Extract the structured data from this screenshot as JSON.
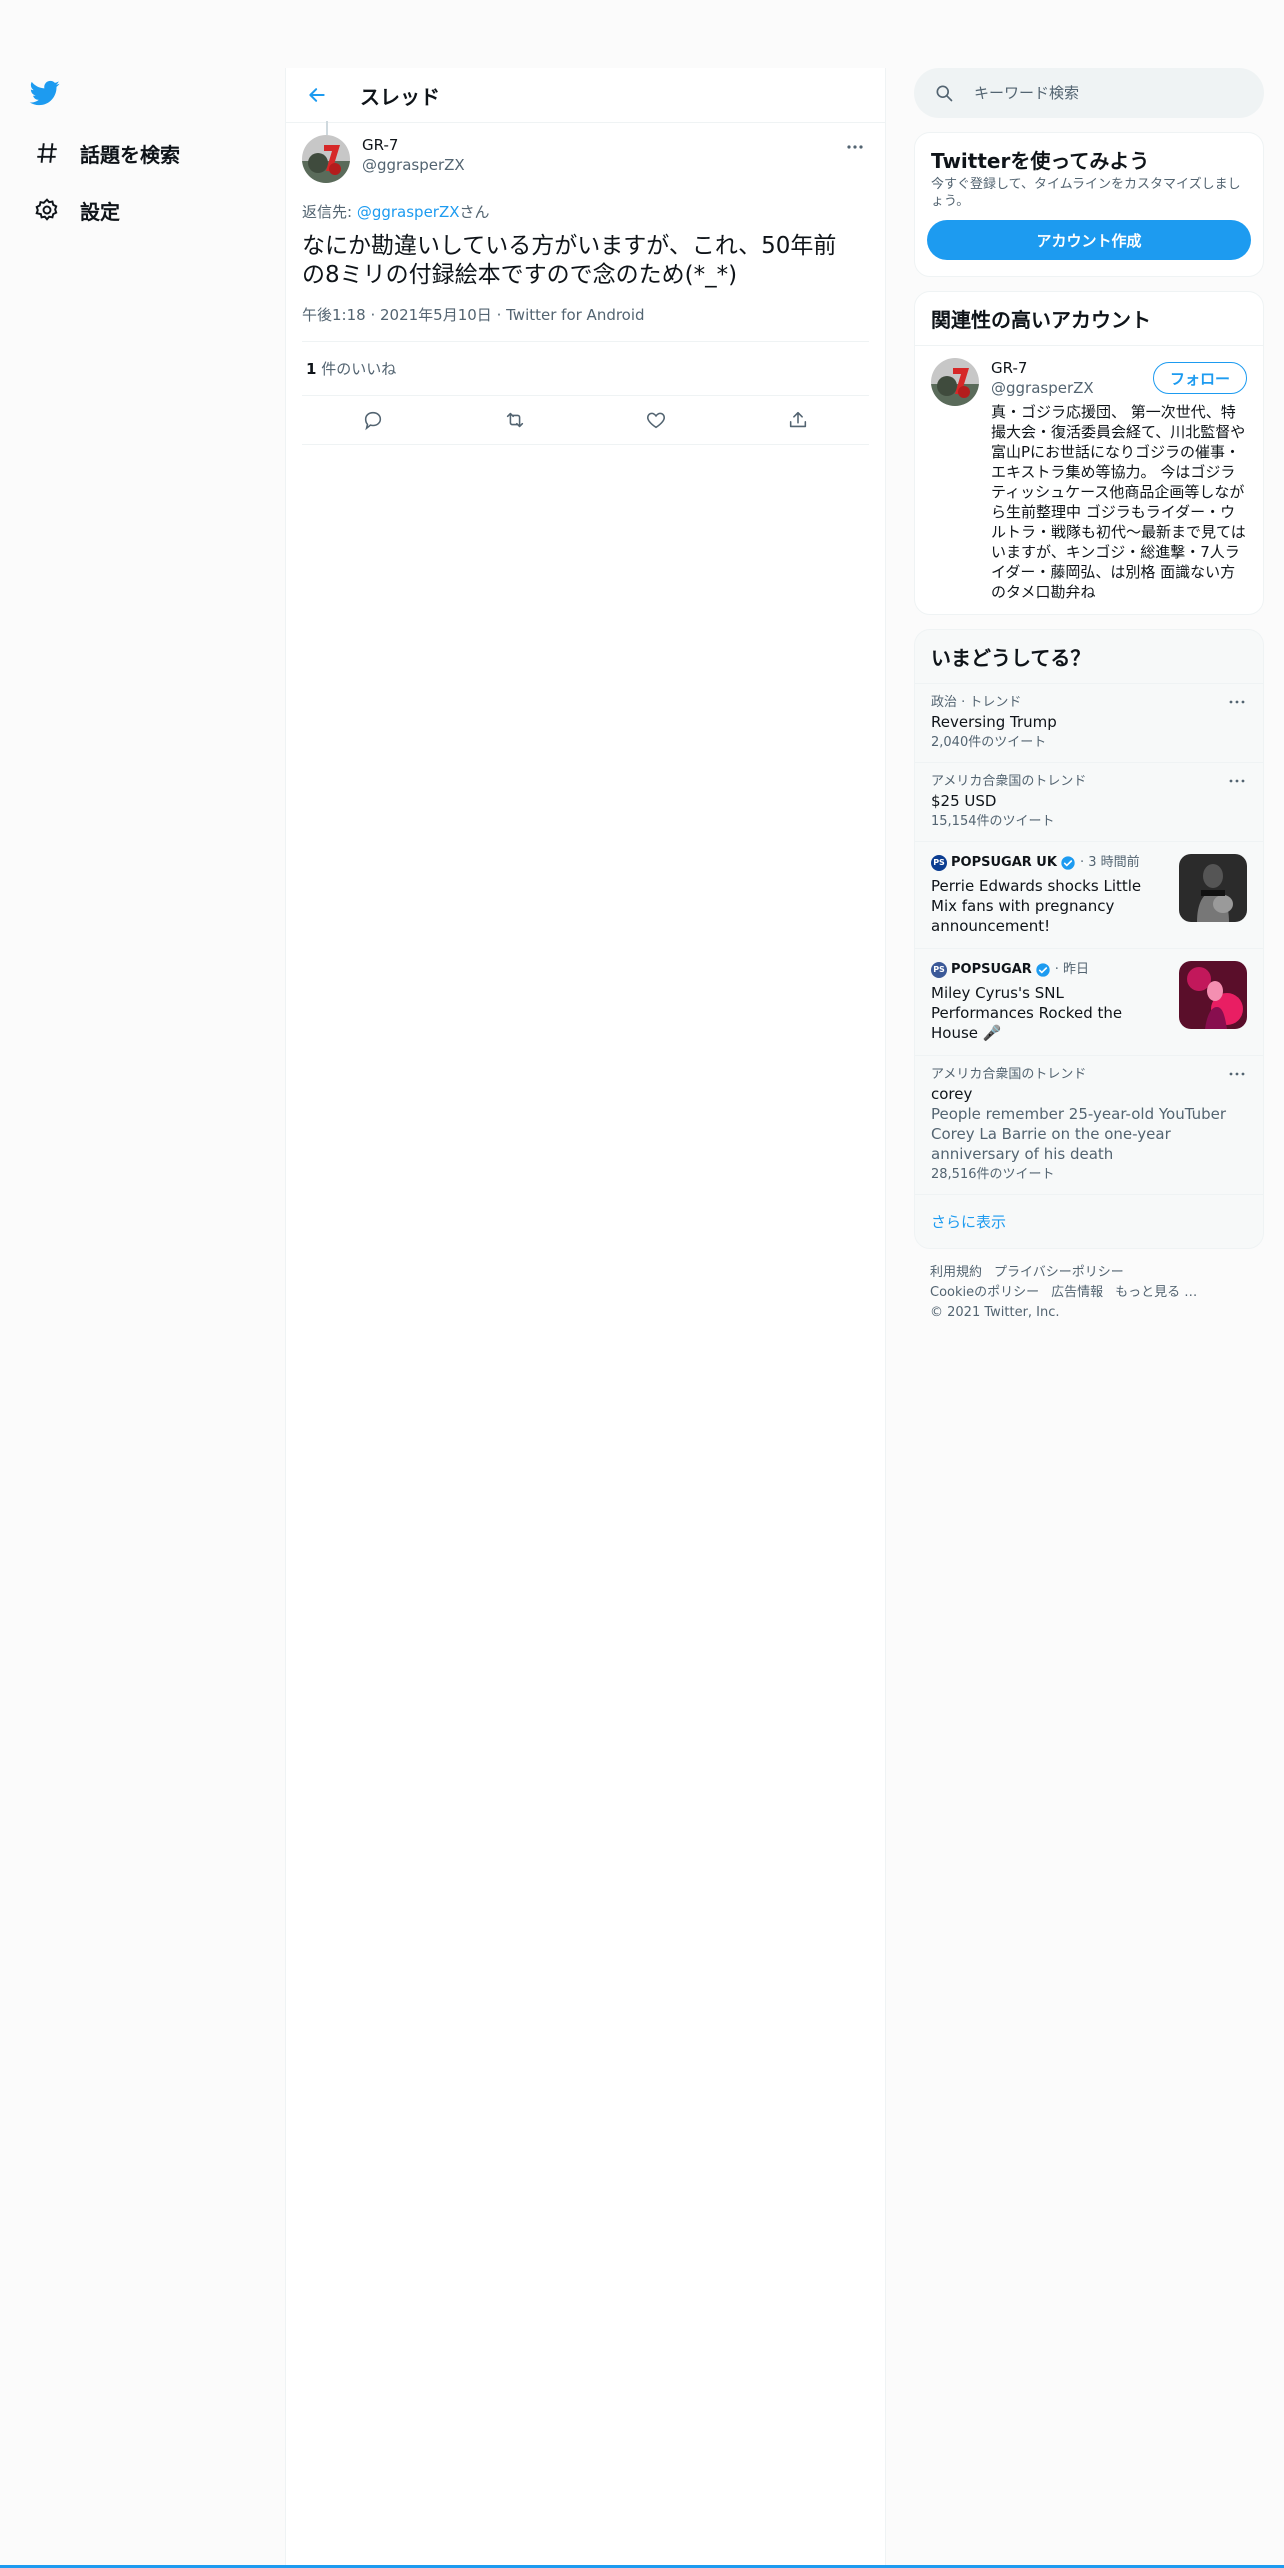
{
  "nav": {
    "explore_label": "話題を検索",
    "settings_label": "設定"
  },
  "header": {
    "title": "スレッド"
  },
  "tweet": {
    "name": "GR-7",
    "handle": "@ggrasperZX",
    "reply_prefix": "返信先: ",
    "reply_handle": "@ggrasperZX",
    "reply_suffix": "さん",
    "text": "なにか勘違いしている方がいますが、これ、50年前の8ミリの付録絵本ですので念のため(*_*)",
    "time": "午後1:18",
    "date": "2021年5月10日",
    "source": "Twitter for Android",
    "likes_count": "1",
    "likes_label": " 件のいいね"
  },
  "search": {
    "placeholder": "キーワード検索"
  },
  "signup": {
    "title": "Twitterを使ってみよう",
    "desc": "今すぐ登録して、タイムラインをカスタマイズしましょう。",
    "button": "アカウント作成"
  },
  "related": {
    "title": "関連性の高いアカウント",
    "name": "GR-7",
    "handle": "@ggrasperZX",
    "follow": "フォロー",
    "bio": "真・ゴジラ応援団、 第一次世代、特撮大会・復活委員会経て、川北監督や富山Pにお世話になりゴジラの催事・エキストラ集め等協力。 今はゴジラティッシュケース他商品企画等しながら生前整理中 ゴジラもライダー・ウルトラ・戦隊も初代～最新まで見てはいますが、キンゴジ・総進撃・7人ライダー・藤岡弘、は別格 面識ない方のタメ口勘弁ね"
  },
  "trends": {
    "title": "いまどうしてる？",
    "items": [
      {
        "context": "政治 · トレンド",
        "name": "Reversing Trump",
        "count": "2,040件のツイート"
      },
      {
        "context": "アメリカ合衆国のトレンド",
        "name": "$25 USD",
        "count": "15,154件のツイート"
      }
    ],
    "news": [
      {
        "badge": "PS",
        "source": "POPSUGAR UK",
        "time": "· 3 時間前",
        "title": "Perrie Edwards shocks Little Mix fans with pregnancy announcement!"
      },
      {
        "badge": "PS",
        "source": "POPSUGAR",
        "time": "· 昨日",
        "title": "Miley Cyrus's SNL Performances Rocked the House 🎤"
      }
    ],
    "last": {
      "context": "アメリカ合衆国のトレンド",
      "name": "corey",
      "desc": "People remember 25-year-old YouTuber Corey La Barrie on the one-year anniversary of his death",
      "count": "28,516件のツイート"
    },
    "show_more": "さらに表示"
  },
  "footer": {
    "terms": "利用規約",
    "privacy": "プライバシーポリシー",
    "cookies": "Cookieのポリシー",
    "ads": "広告情報",
    "more": "もっと見る …",
    "copyright": "© 2021 Twitter, Inc."
  },
  "colors": {
    "accent": "#1d9bf0",
    "text": "#0f1419",
    "muted": "#536471"
  }
}
